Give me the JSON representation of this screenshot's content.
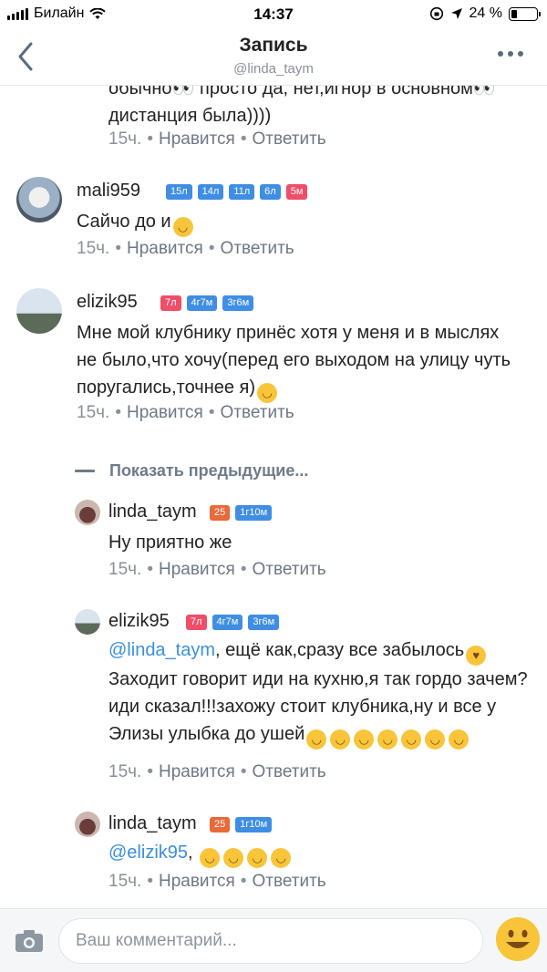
{
  "status_bar": {
    "carrier": "Билайн",
    "time": "14:37",
    "battery": "24 %"
  },
  "header": {
    "title": "Запись",
    "subtitle": "@linda_taym"
  },
  "comments": [
    {
      "username": "",
      "text": "обычно👀 просто да, нет,игнор в основном👀 дистанция была))))",
      "time": "15ч.",
      "like": "Нравится",
      "reply": "Ответить"
    },
    {
      "username": "mali959",
      "badges": [
        "15л",
        "14л",
        "11л",
        "6л",
        "5м"
      ],
      "text": "Сайчо до и",
      "time": "15ч.",
      "like": "Нравится",
      "reply": "Ответить"
    },
    {
      "username": "elizik95",
      "badges": [
        "7л",
        "4г7м",
        "3г6м"
      ],
      "text": "Мне мой клубнику принёс хотя у меня и в мыслях не было,что хочу(перед его выходом на улицу чуть поругались,точнее я)",
      "time": "15ч.",
      "like": "Нравится",
      "reply": "Ответить"
    },
    {
      "username": "linda_taym",
      "badges": [
        "25",
        "1г10м"
      ],
      "text": "Ну приятно же",
      "time": "15ч.",
      "like": "Нравится",
      "reply": "Ответить"
    },
    {
      "username": "elizik95",
      "badges": [
        "7л",
        "4г7м",
        "3г6м"
      ],
      "mention": "@linda_taym",
      "text": ", ещё как,сразу все забылось",
      "text2": "Заходит говорит иди на кухню,я так гордо зачем?иди сказал!!!захожу стоит клубника,ну и все у Элизы улыбка до ушей",
      "time": "15ч.",
      "like": "Нравится",
      "reply": "Ответить"
    },
    {
      "username": "linda_taym",
      "badges": [
        "25",
        "1г10м"
      ],
      "mention": "@elizik95",
      "text": ",",
      "time": "15ч.",
      "like": "Нравится",
      "reply": "Ответить"
    }
  ],
  "show_previous": "Показать предыдущие...",
  "composer": {
    "placeholder": "Ваш комментарий..."
  },
  "colors": {
    "accent": "#3a8fe0",
    "badge_blue": "#3f8ee3",
    "badge_red": "#ef4e69",
    "badge_orange": "#e8693a",
    "emoji": "#f8c53a"
  },
  "icons": [
    "back-chevron-icon",
    "more-dots-icon",
    "camera-icon",
    "smile-emoji-icon",
    "wifi-icon",
    "battery-icon"
  ]
}
